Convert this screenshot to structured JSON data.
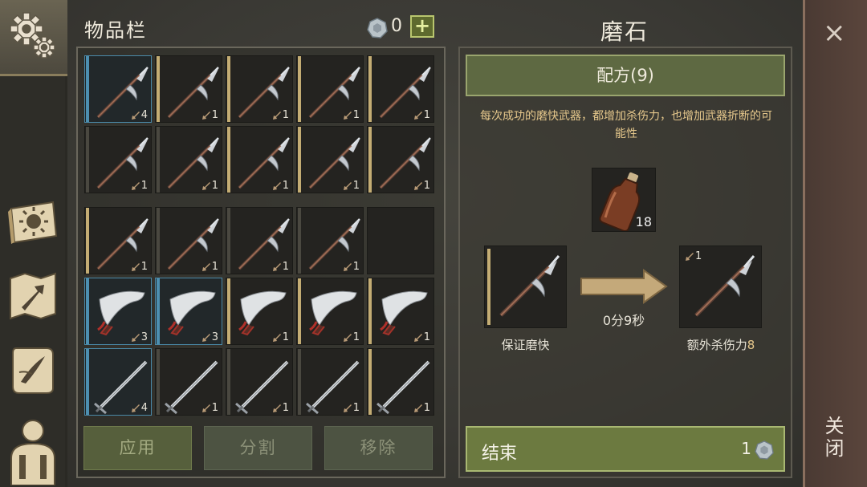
{
  "inventory": {
    "title": "物品栏",
    "currency_count": "0",
    "add_label": "+",
    "actions": {
      "apply": "应用",
      "split": "分割",
      "remove": "移除"
    },
    "slots": [
      {
        "item": "halberd",
        "count": "4",
        "selected": true
      },
      {
        "item": "halberd",
        "count": "1"
      },
      {
        "item": "halberd",
        "count": "1"
      },
      {
        "item": "halberd",
        "count": "1"
      },
      {
        "item": "halberd",
        "count": "1"
      },
      {
        "item": "halberd",
        "count": "1"
      },
      {
        "item": "halberd",
        "count": "1"
      },
      {
        "item": "halberd",
        "count": "1"
      },
      {
        "item": "halberd",
        "count": "1"
      },
      {
        "item": "halberd",
        "count": "1"
      },
      {
        "item": "halberd",
        "count": "1"
      },
      {
        "item": "halberd",
        "count": "1"
      },
      {
        "item": "halberd",
        "count": "1"
      },
      {
        "item": "halberd",
        "count": "1"
      },
      {
        "item": "empty",
        "count": ""
      },
      {
        "item": "scimitar",
        "count": "3",
        "selected": true
      },
      {
        "item": "scimitar",
        "count": "3",
        "selected": true
      },
      {
        "item": "scimitar",
        "count": "1"
      },
      {
        "item": "scimitar",
        "count": "1"
      },
      {
        "item": "scimitar",
        "count": "1"
      },
      {
        "item": "sword",
        "count": "4",
        "selected": true
      },
      {
        "item": "sword",
        "count": "1"
      },
      {
        "item": "sword",
        "count": "1"
      },
      {
        "item": "sword",
        "count": "1"
      },
      {
        "item": "sword",
        "count": "1"
      }
    ]
  },
  "crafting": {
    "title": "磨石",
    "recipe_label": "配方(9)",
    "description": "每次成功的磨快武器，都增加杀伤力，也增加武器折断的可能性",
    "material_count": "18",
    "input_label": "保证磨快",
    "timer": "0分9秒",
    "output_count": "1",
    "output_label_prefix": "额外杀伤力",
    "output_label_value": "8",
    "finish_label": "结束",
    "finish_cost": "1"
  },
  "close": {
    "label": "关闭",
    "x": "×"
  },
  "sidebar": {
    "icons": [
      "settings-gear-icon",
      "sun-book-icon",
      "crafting-map-icon",
      "quest-scroll-icon",
      "character-icon"
    ]
  },
  "colors": {
    "accent_green": "#6c7a40",
    "gold_text": "#e6c88c",
    "selected_blue": "#4d8fb0"
  }
}
